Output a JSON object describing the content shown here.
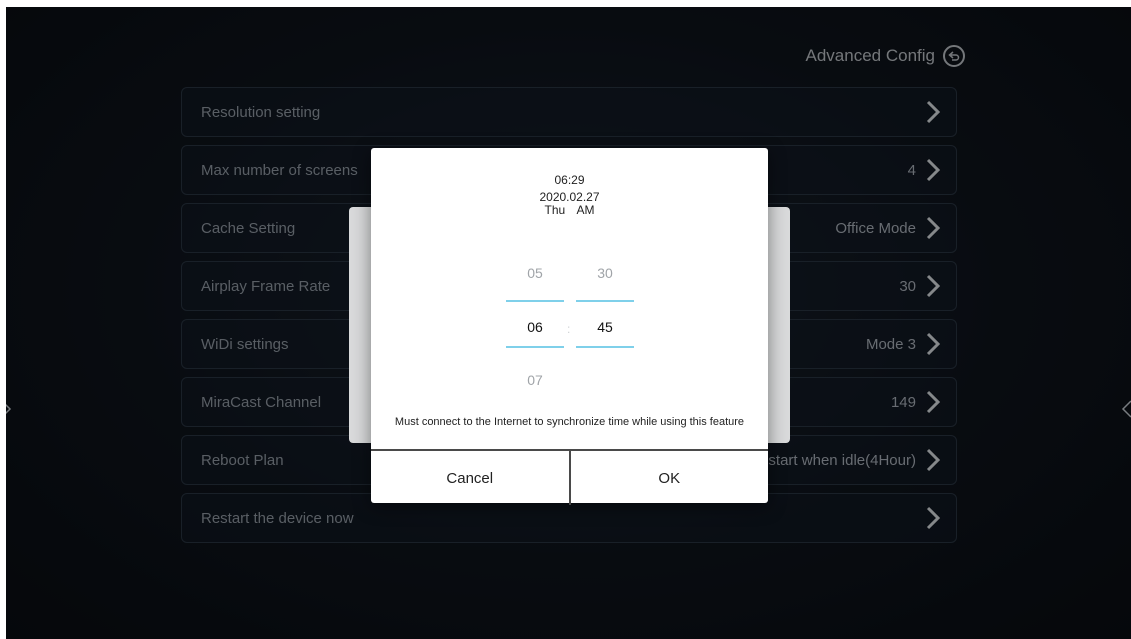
{
  "header": {
    "title": "Advanced Config",
    "back_icon": "back-arrow-circle-icon"
  },
  "settings": [
    {
      "label": "Resolution setting",
      "value": ""
    },
    {
      "label": "Max number of screens",
      "value": "4"
    },
    {
      "label": "Cache Setting",
      "value": "Office Mode"
    },
    {
      "label": "Airplay Frame Rate",
      "value": "30"
    },
    {
      "label": "WiDi settings",
      "value": "Mode 3"
    },
    {
      "label": "MiraCast Channel",
      "value": "149"
    },
    {
      "label": "Reboot Plan",
      "value": "Restart when idle(4Hour)"
    },
    {
      "label": "Restart the device now",
      "value": ""
    }
  ],
  "dialog": {
    "time": "06:29",
    "date": "2020.02.27",
    "day": "Thu",
    "ampm": "AM",
    "hour_picker": {
      "prev": "05",
      "current": "06",
      "next": "07"
    },
    "minute_picker": {
      "prev": "30",
      "current": "45"
    },
    "separator": ":",
    "notice": "Must connect to the Internet to synchronize time while using this feature",
    "cancel_label": "Cancel",
    "ok_label": "OK"
  },
  "colors": {
    "accent": "#7fd0ea",
    "background": "#0f151d",
    "row_border": "#2c3846"
  }
}
